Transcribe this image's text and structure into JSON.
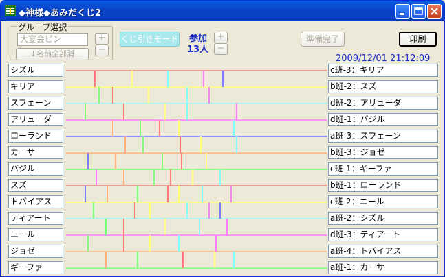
{
  "window": {
    "title": "◆神様◆あみだくじ2",
    "buttons": [
      "minimize",
      "maximize",
      "close"
    ]
  },
  "group": {
    "label": "グループ選択",
    "value": "大宴会ピン",
    "clear_label": "↓名前全部消",
    "plus": "+",
    "minus": "−"
  },
  "kuji_mode_label": "くじ引きモード",
  "participants": {
    "label": "参加",
    "count": "13人",
    "plus": "+",
    "minus": "−"
  },
  "ready_label": "準備完了",
  "print_label": "印刷",
  "datetime": "2009/12/01 21:12:09",
  "colors": {
    "lines": [
      "#ff7b7b",
      "#ffff7b",
      "#7bffff",
      "#ff7bff",
      "#7b7bff",
      "#ffb07b",
      "#7bff7b",
      "#ff7b7b",
      "#ffff7b",
      "#7bffff",
      "#ff7bff",
      "#ffb07b",
      "#7bff7b"
    ],
    "label_blue": "#1c2cc8",
    "kuji_button": "#a9e8ec"
  },
  "names": [
    "シズル",
    "キリア",
    "スフェーン",
    "アリューダ",
    "ローランド",
    "カーサ",
    "バジル",
    "スズ",
    "トバイアス",
    "ティアート",
    "ニール",
    "ジョゼ",
    "ギーファ"
  ],
  "results": [
    "c班-3：キリア",
    "b班-2：スズ",
    "d班-2：アリューダ",
    "d班-1：バジル",
    "a班-3：スフェーン",
    "b班-3：ジョゼ",
    "c班-1：ギーファ",
    "b班-1：ローランド",
    "c班-2：ニール",
    "a班-2：シズル",
    "d班-3：ティアート",
    "a班-4：トバイアス",
    "a班-1：カーサ"
  ]
}
